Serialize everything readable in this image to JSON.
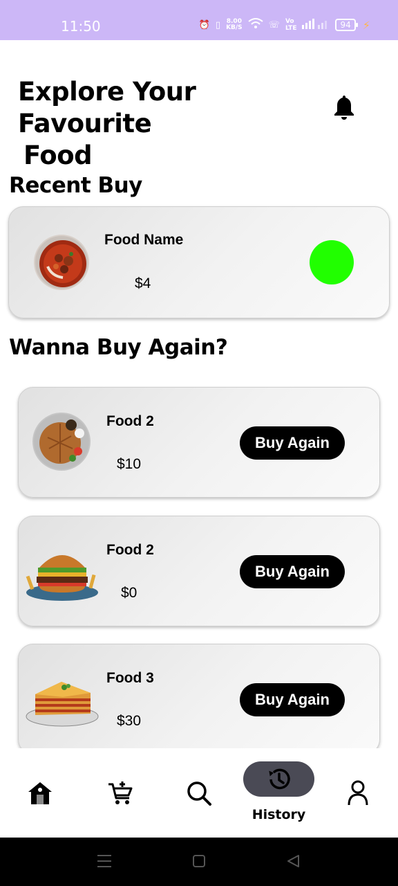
{
  "status_bar": {
    "time": "11:50",
    "net_speed_value": "8.00",
    "net_speed_unit": "KB/S",
    "battery": "94",
    "background": "#ccb7f7"
  },
  "header": {
    "title_line1": "Explore Your Favourite",
    "title_line2": "Food",
    "bell_icon": "bell-icon"
  },
  "recent": {
    "heading": "Recent Buy",
    "item": {
      "name": "Food Name",
      "price": "$4",
      "status_color": "#21ff00"
    }
  },
  "buy_again": {
    "heading": "Wanna Buy Again?",
    "items": [
      {
        "name": "Food 2",
        "price": "$10",
        "button": "Buy Again"
      },
      {
        "name": "Food 2",
        "price": "$0",
        "button": "Buy Again"
      },
      {
        "name": "Food 3",
        "price": "$30",
        "button": "Buy Again"
      }
    ]
  },
  "bottom_nav": {
    "items": [
      "home-icon",
      "cart-icon",
      "search-icon",
      "history-icon",
      "profile-icon"
    ],
    "active_label": "History",
    "active_color": "#4a4a55"
  }
}
